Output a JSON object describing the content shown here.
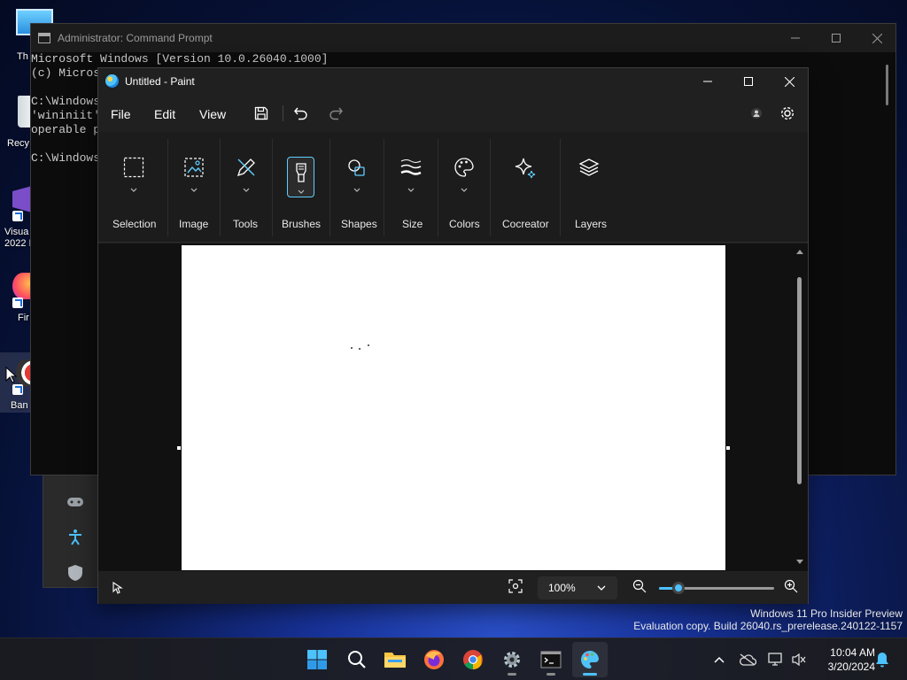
{
  "desktop": {
    "icons": [
      {
        "name": "this-pc",
        "label": "Th"
      },
      {
        "name": "recycle-bin",
        "label": "Recy"
      },
      {
        "name": "visual-studio",
        "label": "Visua\n2022 I"
      },
      {
        "name": "firefox",
        "label": "Fir"
      },
      {
        "name": "bandicam",
        "label": "Ban"
      }
    ]
  },
  "cmd": {
    "title": "Administrator: Command Prompt",
    "lines": "Microsoft Windows [Version 10.0.26040.1000]\n(c) Micros\n\nC:\\Windows\n'wininiit'\noperable p\n\nC:\\Windows"
  },
  "paint": {
    "title": "Untitled - Paint",
    "menu": {
      "file": "File",
      "edit": "Edit",
      "view": "View"
    },
    "tools": [
      {
        "label": "Selection"
      },
      {
        "label": "Image"
      },
      {
        "label": "Tools"
      },
      {
        "label": "Brushes"
      },
      {
        "label": "Shapes"
      },
      {
        "label": "Size"
      },
      {
        "label": "Colors"
      },
      {
        "label": "Cocreator"
      },
      {
        "label": "Layers"
      }
    ],
    "status": {
      "zoom": "100%",
      "zoom_fraction": 0.17
    }
  },
  "watermark": {
    "line1": "Windows 11 Pro Insider Preview",
    "line2": "Evaluation copy. Build 26040.rs_prerelease.240122-1157"
  },
  "taskbar": {
    "time": "10:04 AM",
    "date": "3/20/2024"
  },
  "colors": {
    "accent": "#4cc2ff",
    "titlebar": "#202020",
    "canvas": "#ffffff"
  }
}
